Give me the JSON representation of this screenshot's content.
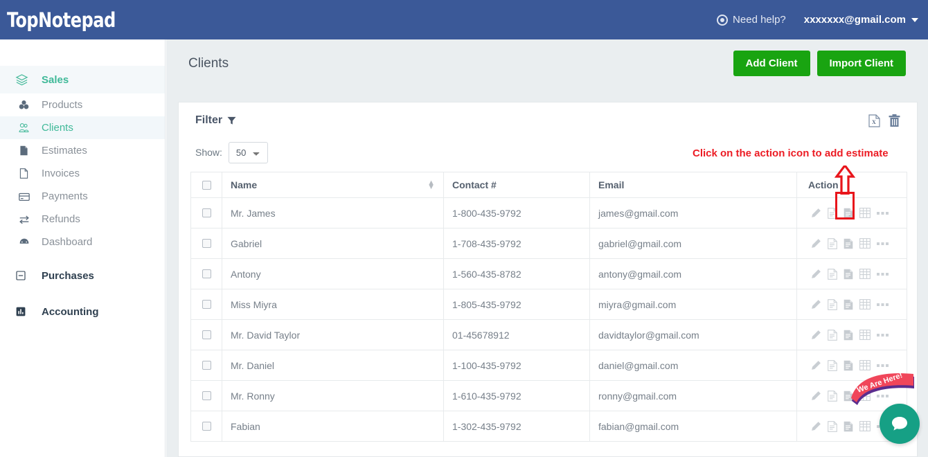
{
  "topbar": {
    "logo_top": "Top",
    "logo_note": "Notepad",
    "logo_full": "TopNotepad",
    "help_label": "Need help?",
    "account_email": "xxxxxxx@gmail.com",
    "bg_color": "#3b5998"
  },
  "sidebar": {
    "groups": [
      {
        "label": "Sales",
        "icon": "layers-icon",
        "active": true
      },
      {
        "label": "Purchases",
        "icon": "minus-square-icon",
        "active": false
      },
      {
        "label": "Accounting",
        "icon": "bar-chart-icon",
        "active": false
      }
    ],
    "items": [
      {
        "label": "Products",
        "icon": "products-icon"
      },
      {
        "label": "Clients",
        "icon": "clients-icon"
      },
      {
        "label": "Estimates",
        "icon": "estimates-icon"
      },
      {
        "label": "Invoices",
        "icon": "invoices-icon"
      },
      {
        "label": "Payments",
        "icon": "payments-icon"
      },
      {
        "label": "Refunds",
        "icon": "refunds-icon"
      },
      {
        "label": "Dashboard",
        "icon": "dashboard-icon"
      }
    ],
    "active_item": "Clients",
    "accent_color": "#3fb998"
  },
  "page": {
    "title": "Clients",
    "add_client_label": "Add Client",
    "import_client_label": "Import Client",
    "button_color": "#19a411"
  },
  "card": {
    "filter_label": "Filter",
    "export_icon": "excel-export-icon",
    "delete_icon": "trash-icon",
    "show_label": "Show:",
    "show_value": "50",
    "show_options": [
      "50"
    ]
  },
  "annotation": {
    "text": "Click on the action icon to add estimate",
    "color": "#ec1c24"
  },
  "table": {
    "headers": [
      "",
      "Name",
      "Contact #",
      "Email",
      "Action"
    ],
    "rows": [
      {
        "name": "Mr. James",
        "contact": "1-800-435-9792",
        "email": "james@gmail.com"
      },
      {
        "name": "Gabriel",
        "contact": "1-708-435-9792",
        "email": "gabriel@gmail.com"
      },
      {
        "name": "Antony",
        "contact": "1-560-435-8782",
        "email": "antony@gmail.com"
      },
      {
        "name": "Miss Miyra",
        "contact": "1-805-435-9792",
        "email": "miyra@gmail.com"
      },
      {
        "name": "Mr. David Taylor",
        "contact": "01-45678912",
        "email": "davidtaylor@gmail.com"
      },
      {
        "name": "Mr. Daniel",
        "contact": "1-100-435-9792",
        "email": "daniel@gmail.com"
      },
      {
        "name": "Mr. Ronny",
        "contact": "1-610-435-9792",
        "email": "ronny@gmail.com"
      },
      {
        "name": "Fabian",
        "contact": "1-302-435-9792",
        "email": "fabian@gmail.com"
      }
    ],
    "action_icons": [
      "edit-pencil-icon",
      "document-icon",
      "estimate-icon",
      "table-grid-icon",
      "more-ellipsis-icon"
    ]
  },
  "chat_widget": {
    "ribbon_text": "We Are Here!",
    "ribbon_color": "#f0465a",
    "button_color": "#16a085",
    "button_icon": "chat-bubble-icon"
  }
}
